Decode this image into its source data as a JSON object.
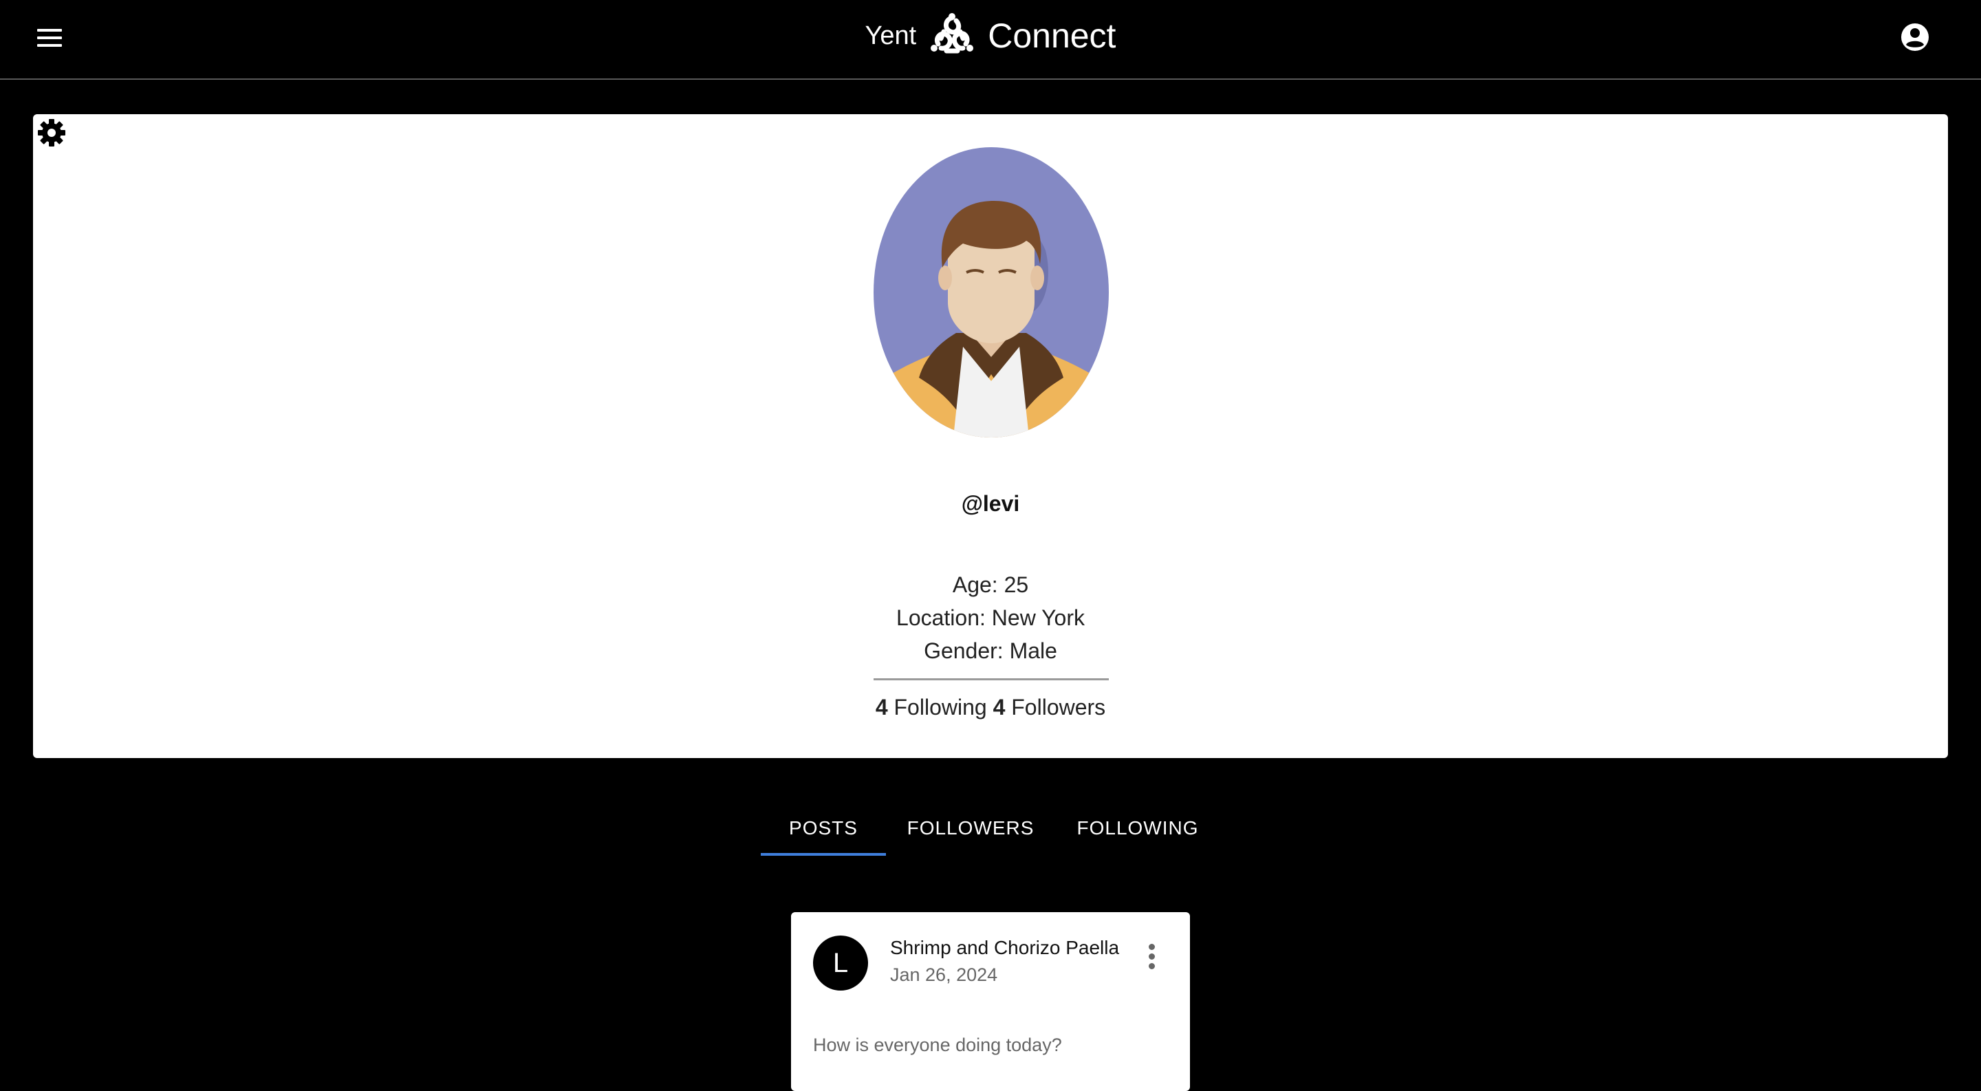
{
  "header": {
    "brand_left": "Yent",
    "brand_right": "Connect",
    "menu_icon": "hamburger-menu-icon",
    "logo_icon": "yent-connect-logo-icon",
    "account_icon": "account-circle-icon"
  },
  "profile": {
    "settings_icon": "gear-icon",
    "avatar_alt": "Profile avatar",
    "username": "@levi",
    "age_line": "Age: 25",
    "location_line": "Location: New York",
    "gender_line": "Gender: Male",
    "following_count": "4",
    "following_label": "Following",
    "followers_count": "4",
    "followers_label": "Followers"
  },
  "tabs": {
    "items": [
      {
        "label": "POSTS",
        "active": true
      },
      {
        "label": "FOLLOWERS",
        "active": false
      },
      {
        "label": "FOLLOWING",
        "active": false
      }
    ],
    "indicator_color": "#3f7fdc"
  },
  "posts": [
    {
      "avatar_letter": "L",
      "title": "Shrimp and Chorizo Paella",
      "date": "Jan 26, 2024",
      "body": "How is everyone doing today?",
      "menu_icon": "more-vert-icon"
    }
  ],
  "colors": {
    "background": "#000000",
    "card": "#ffffff",
    "accent": "#3f7fdc"
  }
}
